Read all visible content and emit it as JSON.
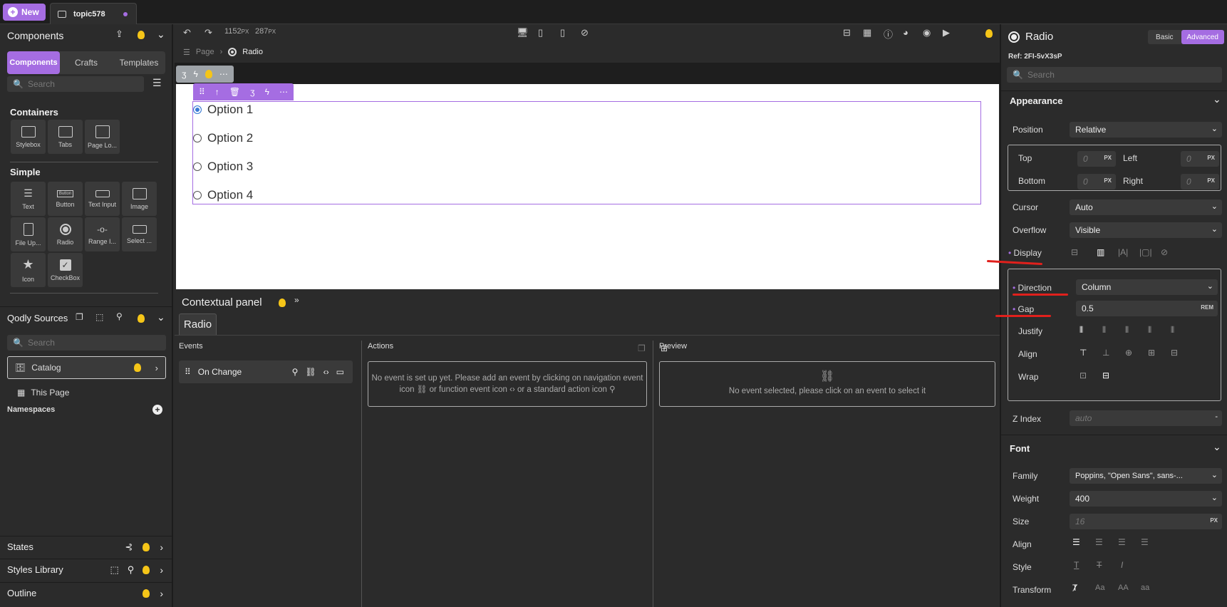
{
  "topbar": {
    "new_label": "New",
    "tab_label": "topic578"
  },
  "left": {
    "title": "Components",
    "tabs": [
      "Components",
      "Crafts",
      "Templates"
    ],
    "search_placeholder": "Search",
    "containers_title": "Containers",
    "containers": [
      "Stylebox",
      "Tabs",
      "Page Lo..."
    ],
    "simple_title": "Simple",
    "simple": [
      "Text",
      "Button",
      "Text Input",
      "Image",
      "File Up...",
      "Radio",
      "Range I...",
      "Select ...",
      "Icon",
      "CheckBox"
    ],
    "button_icon_text": "Button",
    "sources_title": "Qodly Sources",
    "sources_search": "Search",
    "catalog": "Catalog",
    "this_page": "This Page",
    "namespaces": "Namespaces",
    "states": "States",
    "styles_library": "Styles Library",
    "outline": "Outline"
  },
  "toolbar": {
    "width": "1152",
    "width_unit": "PX",
    "height": "287",
    "height_unit": "PX"
  },
  "breadcrumb": {
    "page": "Page",
    "current": "Radio"
  },
  "canvas": {
    "options": [
      "Option 1",
      "Option 2",
      "Option 3",
      "Option 4"
    ],
    "selected_index": 0
  },
  "contextual": {
    "title": "Contextual panel",
    "tab": "Radio",
    "events_title": "Events",
    "event": "On Change",
    "actions_title": "Actions",
    "actions_msg_1": "No event is set up yet. Please add an event by clicking on navigation event",
    "actions_msg_2": "icon",
    "actions_msg_3": "or function event icon",
    "actions_msg_4": "or a standard action icon",
    "preview_title": "Preview",
    "preview_msg": "No event selected, please click on an event to select it"
  },
  "right": {
    "title": "Radio",
    "mode_basic": "Basic",
    "mode_advanced": "Advanced",
    "ref": "Ref: 2FI-5vX3sP",
    "search": "Search",
    "appearance": "Appearance",
    "position_label": "Position",
    "position": "Relative",
    "top": "Top",
    "left": "Left",
    "bottom": "Bottom",
    "right": "Right",
    "zero": "0",
    "px": "PX",
    "cursor_label": "Cursor",
    "cursor": "Auto",
    "overflow_label": "Overflow",
    "overflow": "Visible",
    "display_label": "Display",
    "direction_label": "Direction",
    "direction": "Column",
    "gap_label": "Gap",
    "gap": "0.5",
    "gap_unit": "REM",
    "justify": "Justify",
    "align": "Align",
    "wrap": "Wrap",
    "zindex_label": "Z Index",
    "zindex": "auto",
    "zindex_dash": "-",
    "font": "Font",
    "family_label": "Family",
    "family": "Poppins, \"Open Sans\", sans-...",
    "weight_label": "Weight",
    "weight": "400",
    "size_label": "Size",
    "size": "16",
    "size_unit": "PX",
    "falign_label": "Align",
    "style_label": "Style",
    "transform_label": "Transform",
    "transform_opts": [
      "Aa",
      "AA",
      "aa"
    ]
  },
  "colors": {
    "accent": "#a56de2",
    "annotation": "#e0201c",
    "bulb": "#f5c518"
  }
}
